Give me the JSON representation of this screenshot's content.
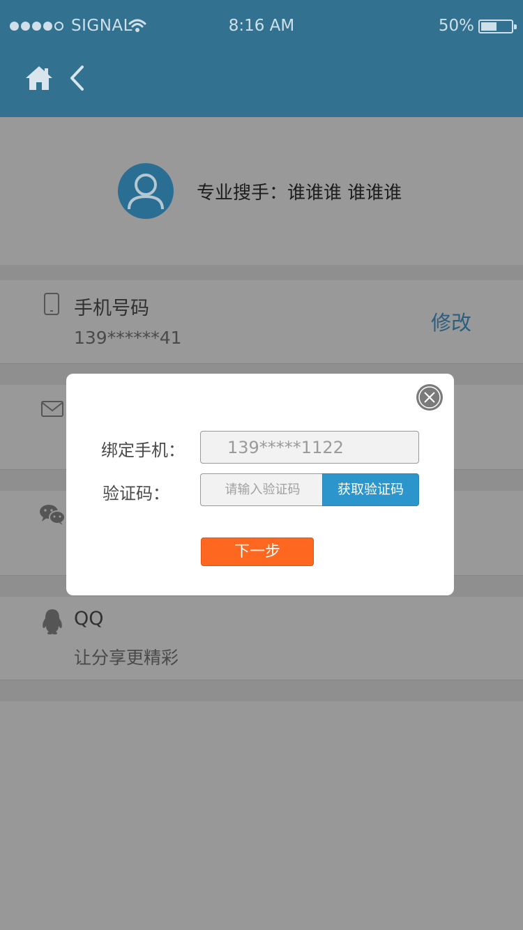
{
  "status_bar": {
    "carrier": "SIGNAL",
    "time": "8:16 AM",
    "battery_percent": "50%",
    "battery_level": 0.5
  },
  "nav": {
    "home_icon": "home-icon",
    "back_icon": "chevron-left-icon"
  },
  "profile": {
    "name": "专业搜手：谁谁谁 谁谁谁"
  },
  "rows": {
    "phone": {
      "title": "手机号码",
      "value": "139******41",
      "action": "修改"
    },
    "qq": {
      "title": "QQ",
      "subtitle": "让分享更精彩"
    }
  },
  "modal": {
    "phone_label": "绑定手机：",
    "phone_value": "139*****1122",
    "code_label": "验证码：",
    "code_placeholder": "请输入验证码",
    "get_code_button": "获取验证码",
    "next_button": "下一步"
  },
  "colors": {
    "nav_bar": "#32718f",
    "accent_blue": "#2c95cc",
    "next_orange": "#fd6720",
    "overlay_bg": "#989898"
  }
}
